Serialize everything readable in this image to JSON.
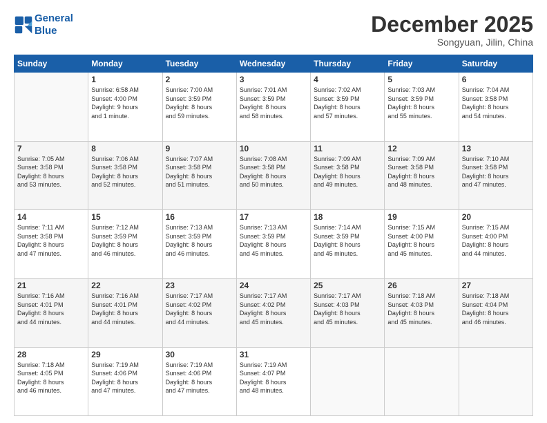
{
  "header": {
    "logo_line1": "General",
    "logo_line2": "Blue",
    "month": "December 2025",
    "location": "Songyuan, Jilin, China"
  },
  "weekdays": [
    "Sunday",
    "Monday",
    "Tuesday",
    "Wednesday",
    "Thursday",
    "Friday",
    "Saturday"
  ],
  "rows": [
    [
      {
        "day": "",
        "text": ""
      },
      {
        "day": "1",
        "text": "Sunrise: 6:58 AM\nSunset: 4:00 PM\nDaylight: 9 hours\nand 1 minute."
      },
      {
        "day": "2",
        "text": "Sunrise: 7:00 AM\nSunset: 3:59 PM\nDaylight: 8 hours\nand 59 minutes."
      },
      {
        "day": "3",
        "text": "Sunrise: 7:01 AM\nSunset: 3:59 PM\nDaylight: 8 hours\nand 58 minutes."
      },
      {
        "day": "4",
        "text": "Sunrise: 7:02 AM\nSunset: 3:59 PM\nDaylight: 8 hours\nand 57 minutes."
      },
      {
        "day": "5",
        "text": "Sunrise: 7:03 AM\nSunset: 3:59 PM\nDaylight: 8 hours\nand 55 minutes."
      },
      {
        "day": "6",
        "text": "Sunrise: 7:04 AM\nSunset: 3:58 PM\nDaylight: 8 hours\nand 54 minutes."
      }
    ],
    [
      {
        "day": "7",
        "text": "Sunrise: 7:05 AM\nSunset: 3:58 PM\nDaylight: 8 hours\nand 53 minutes."
      },
      {
        "day": "8",
        "text": "Sunrise: 7:06 AM\nSunset: 3:58 PM\nDaylight: 8 hours\nand 52 minutes."
      },
      {
        "day": "9",
        "text": "Sunrise: 7:07 AM\nSunset: 3:58 PM\nDaylight: 8 hours\nand 51 minutes."
      },
      {
        "day": "10",
        "text": "Sunrise: 7:08 AM\nSunset: 3:58 PM\nDaylight: 8 hours\nand 50 minutes."
      },
      {
        "day": "11",
        "text": "Sunrise: 7:09 AM\nSunset: 3:58 PM\nDaylight: 8 hours\nand 49 minutes."
      },
      {
        "day": "12",
        "text": "Sunrise: 7:09 AM\nSunset: 3:58 PM\nDaylight: 8 hours\nand 48 minutes."
      },
      {
        "day": "13",
        "text": "Sunrise: 7:10 AM\nSunset: 3:58 PM\nDaylight: 8 hours\nand 47 minutes."
      }
    ],
    [
      {
        "day": "14",
        "text": "Sunrise: 7:11 AM\nSunset: 3:58 PM\nDaylight: 8 hours\nand 47 minutes."
      },
      {
        "day": "15",
        "text": "Sunrise: 7:12 AM\nSunset: 3:59 PM\nDaylight: 8 hours\nand 46 minutes."
      },
      {
        "day": "16",
        "text": "Sunrise: 7:13 AM\nSunset: 3:59 PM\nDaylight: 8 hours\nand 46 minutes."
      },
      {
        "day": "17",
        "text": "Sunrise: 7:13 AM\nSunset: 3:59 PM\nDaylight: 8 hours\nand 45 minutes."
      },
      {
        "day": "18",
        "text": "Sunrise: 7:14 AM\nSunset: 3:59 PM\nDaylight: 8 hours\nand 45 minutes."
      },
      {
        "day": "19",
        "text": "Sunrise: 7:15 AM\nSunset: 4:00 PM\nDaylight: 8 hours\nand 45 minutes."
      },
      {
        "day": "20",
        "text": "Sunrise: 7:15 AM\nSunset: 4:00 PM\nDaylight: 8 hours\nand 44 minutes."
      }
    ],
    [
      {
        "day": "21",
        "text": "Sunrise: 7:16 AM\nSunset: 4:01 PM\nDaylight: 8 hours\nand 44 minutes."
      },
      {
        "day": "22",
        "text": "Sunrise: 7:16 AM\nSunset: 4:01 PM\nDaylight: 8 hours\nand 44 minutes."
      },
      {
        "day": "23",
        "text": "Sunrise: 7:17 AM\nSunset: 4:02 PM\nDaylight: 8 hours\nand 44 minutes."
      },
      {
        "day": "24",
        "text": "Sunrise: 7:17 AM\nSunset: 4:02 PM\nDaylight: 8 hours\nand 45 minutes."
      },
      {
        "day": "25",
        "text": "Sunrise: 7:17 AM\nSunset: 4:03 PM\nDaylight: 8 hours\nand 45 minutes."
      },
      {
        "day": "26",
        "text": "Sunrise: 7:18 AM\nSunset: 4:03 PM\nDaylight: 8 hours\nand 45 minutes."
      },
      {
        "day": "27",
        "text": "Sunrise: 7:18 AM\nSunset: 4:04 PM\nDaylight: 8 hours\nand 46 minutes."
      }
    ],
    [
      {
        "day": "28",
        "text": "Sunrise: 7:18 AM\nSunset: 4:05 PM\nDaylight: 8 hours\nand 46 minutes."
      },
      {
        "day": "29",
        "text": "Sunrise: 7:19 AM\nSunset: 4:06 PM\nDaylight: 8 hours\nand 47 minutes."
      },
      {
        "day": "30",
        "text": "Sunrise: 7:19 AM\nSunset: 4:06 PM\nDaylight: 8 hours\nand 47 minutes."
      },
      {
        "day": "31",
        "text": "Sunrise: 7:19 AM\nSunset: 4:07 PM\nDaylight: 8 hours\nand 48 minutes."
      },
      {
        "day": "",
        "text": ""
      },
      {
        "day": "",
        "text": ""
      },
      {
        "day": "",
        "text": ""
      }
    ]
  ]
}
